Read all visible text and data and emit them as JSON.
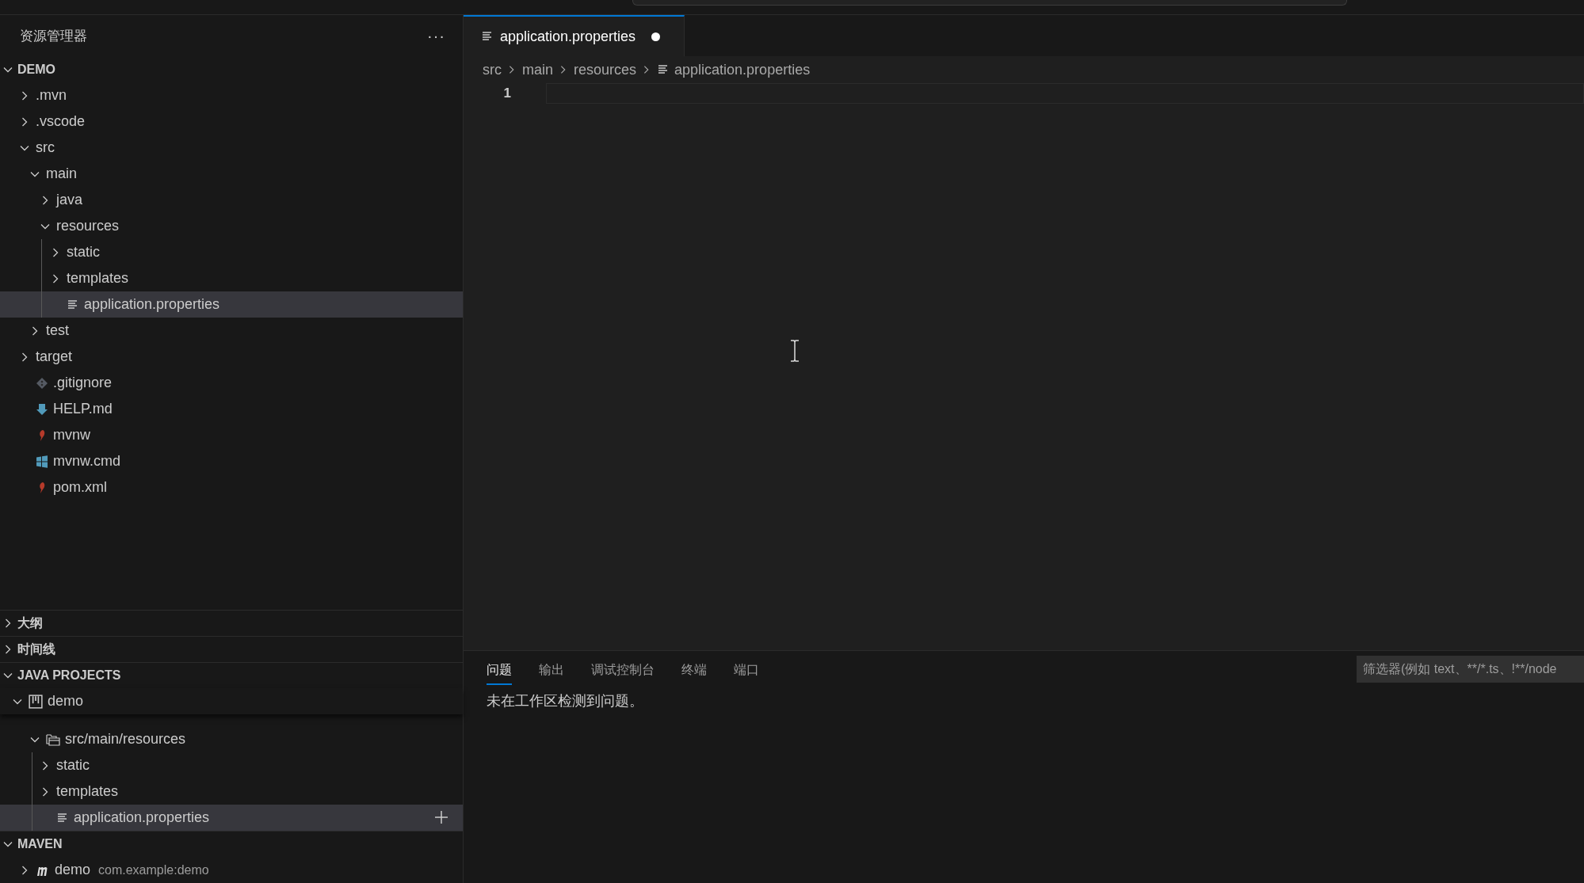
{
  "sidebar": {
    "title": "资源管理器",
    "more": "···",
    "explorer": {
      "title": "DEMO",
      "expanded": true,
      "children": [
        {
          "label": ".mvn",
          "kind": "folder",
          "expanded": false,
          "selected": false
        },
        {
          "label": ".vscode",
          "kind": "folder",
          "expanded": false,
          "selected": false
        },
        {
          "label": "src",
          "kind": "folder",
          "expanded": true,
          "selected": false,
          "children": [
            {
              "label": "main",
              "kind": "folder",
              "expanded": true,
              "selected": false,
              "children": [
                {
                  "label": "java",
                  "kind": "folder",
                  "expanded": false,
                  "selected": false
                },
                {
                  "label": "resources",
                  "kind": "folder",
                  "expanded": true,
                  "selected": false,
                  "children": [
                    {
                      "label": "static",
                      "kind": "folder",
                      "expanded": false,
                      "selected": false
                    },
                    {
                      "label": "templates",
                      "kind": "folder",
                      "expanded": false,
                      "selected": false
                    },
                    {
                      "label": "application.properties",
                      "kind": "properties",
                      "selected": true
                    }
                  ]
                }
              ]
            },
            {
              "label": "test",
              "kind": "folder",
              "expanded": false,
              "selected": false
            }
          ]
        },
        {
          "label": "target",
          "kind": "folder",
          "expanded": false,
          "selected": false
        },
        {
          "label": ".gitignore",
          "kind": "git",
          "selected": false
        },
        {
          "label": "HELP.md",
          "kind": "markdown",
          "selected": false
        },
        {
          "label": "mvnw",
          "kind": "maven",
          "selected": false
        },
        {
          "label": "mvnw.cmd",
          "kind": "windows",
          "selected": false
        },
        {
          "label": "pom.xml",
          "kind": "maven",
          "selected": false
        }
      ]
    },
    "outline": {
      "title": "大纲",
      "expanded": false
    },
    "timeline": {
      "title": "时间线",
      "expanded": false
    },
    "java_projects": {
      "title": "JAVA PROJECTS",
      "expanded": true,
      "project": {
        "label": "demo",
        "kind": "project",
        "expanded": true
      },
      "children": [
        {
          "label": "src/main/resources",
          "kind": "package",
          "expanded": true,
          "selected": false,
          "children": [
            {
              "label": "static",
              "kind": "folder",
              "expanded": false,
              "selected": false
            },
            {
              "label": "templates",
              "kind": "folder",
              "expanded": false,
              "selected": false
            },
            {
              "label": "application.properties",
              "kind": "properties",
              "selected": true
            }
          ]
        }
      ]
    },
    "maven": {
      "title": "MAVEN",
      "expanded": true,
      "children": [
        {
          "label": "demo",
          "detail": "com.example:demo",
          "kind": "mavenproject",
          "expanded": false,
          "selected": false
        }
      ]
    }
  },
  "editor": {
    "tabs": [
      {
        "label": "application.properties",
        "selected": true,
        "modified": true
      }
    ],
    "breadcrumb": [
      "src",
      "main",
      "resources",
      "application.properties"
    ],
    "line_numbers": [
      "1"
    ]
  },
  "panel": {
    "tabs": [
      {
        "label": "问题",
        "selected": true
      },
      {
        "label": "输出",
        "selected": false
      },
      {
        "label": "调试控制台",
        "selected": false
      },
      {
        "label": "终端",
        "selected": false
      },
      {
        "label": "端口",
        "selected": false
      }
    ],
    "filter": {
      "placeholder": "筛选器(例如 text、**/*.ts、!**/node"
    },
    "message": "未在工作区检测到问题。"
  }
}
